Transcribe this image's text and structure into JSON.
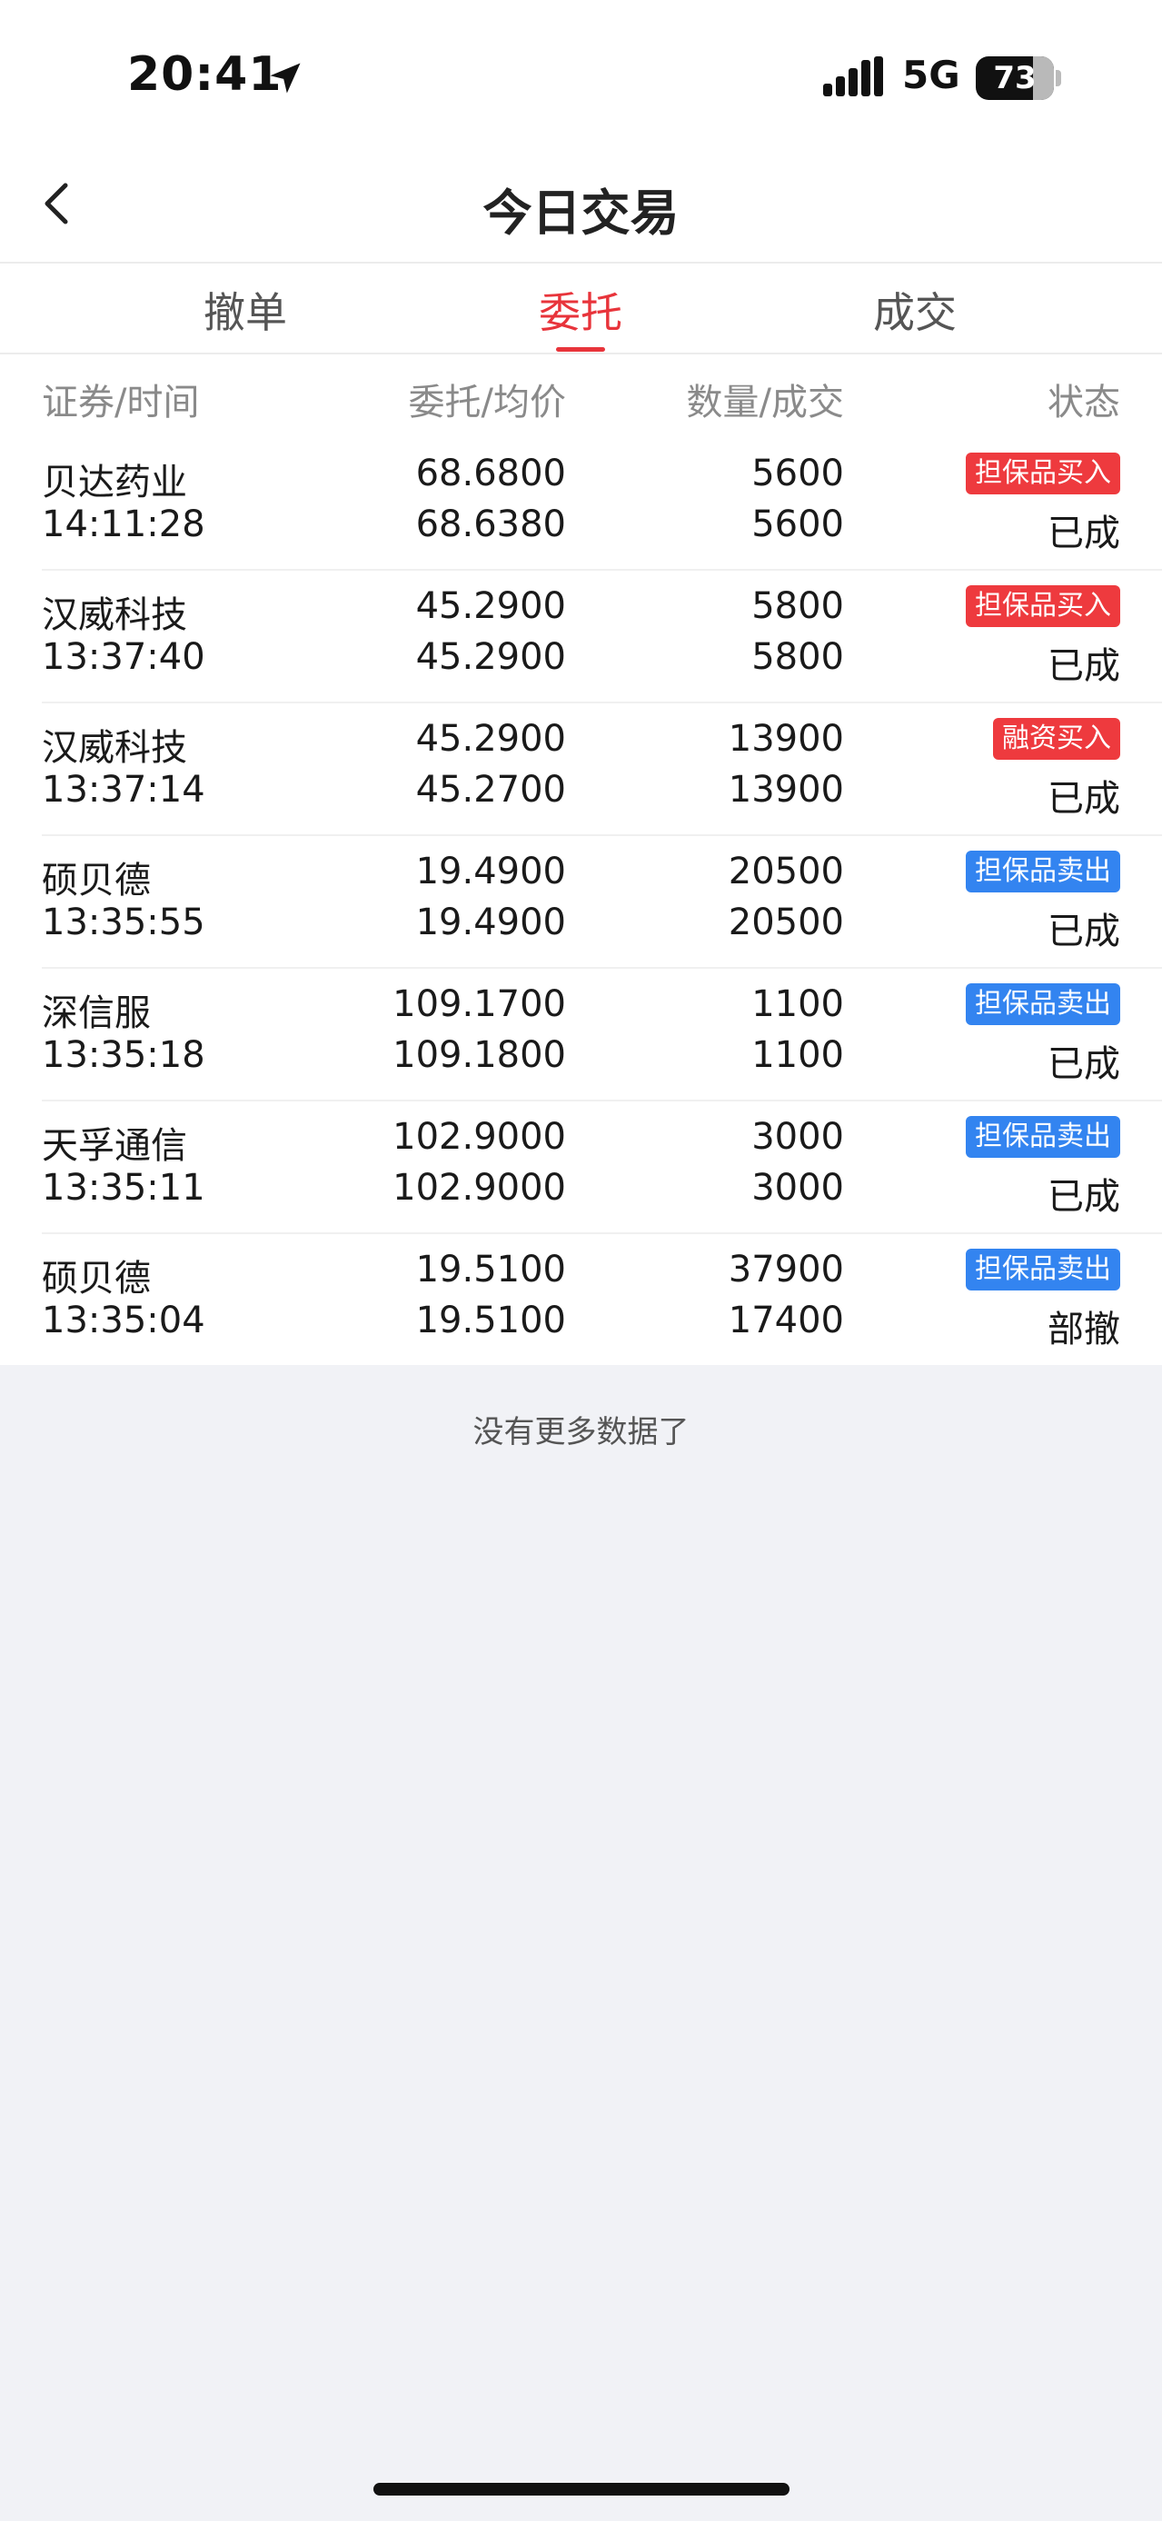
{
  "status_bar": {
    "time": "20:41",
    "network": "5G",
    "battery": "73",
    "battery_level_percent": 73,
    "location_icon": "location-arrow-icon",
    "signal_icon": "cellular-signal-icon"
  },
  "nav": {
    "title": "今日交易",
    "back_icon": "chevron-left-icon"
  },
  "tabs": [
    {
      "label": "撤单",
      "active": false
    },
    {
      "label": "委托",
      "active": true
    },
    {
      "label": "成交",
      "active": false
    }
  ],
  "columns": [
    "证券/时间",
    "委托/均价",
    "数量/成交",
    "状态"
  ],
  "orders": [
    {
      "name": "贝达药业",
      "time": "14:11:28",
      "order_price": "68.6800",
      "avg_price": "68.6380",
      "quantity": "5600",
      "filled": "5600",
      "tag": "担保品买入",
      "tag_color": "#ee3a3e",
      "status": "已成"
    },
    {
      "name": "汉威科技",
      "time": "13:37:40",
      "order_price": "45.2900",
      "avg_price": "45.2900",
      "quantity": "5800",
      "filled": "5800",
      "tag": "担保品买入",
      "tag_color": "#ee3a3e",
      "status": "已成"
    },
    {
      "name": "汉威科技",
      "time": "13:37:14",
      "order_price": "45.2900",
      "avg_price": "45.2700",
      "quantity": "13900",
      "filled": "13900",
      "tag": "融资买入",
      "tag_color": "#ee3a3e",
      "status": "已成"
    },
    {
      "name": "硕贝德",
      "time": "13:35:55",
      "order_price": "19.4900",
      "avg_price": "19.4900",
      "quantity": "20500",
      "filled": "20500",
      "tag": "担保品卖出",
      "tag_color": "#3384f0",
      "status": "已成"
    },
    {
      "name": "深信服",
      "time": "13:35:18",
      "order_price": "109.1700",
      "avg_price": "109.1800",
      "quantity": "1100",
      "filled": "1100",
      "tag": "担保品卖出",
      "tag_color": "#3384f0",
      "status": "已成"
    },
    {
      "name": "天孚通信",
      "time": "13:35:11",
      "order_price": "102.9000",
      "avg_price": "102.9000",
      "quantity": "3000",
      "filled": "3000",
      "tag": "担保品卖出",
      "tag_color": "#3384f0",
      "status": "已成"
    },
    {
      "name": "硕贝德",
      "time": "13:35:04",
      "order_price": "19.5100",
      "avg_price": "19.5100",
      "quantity": "37900",
      "filled": "17400",
      "tag": "担保品卖出",
      "tag_color": "#3384f0",
      "status": "部撤"
    }
  ],
  "footer_text": "没有更多数据了",
  "colors": {
    "accent": "#e8343b",
    "buy_tag": "#ee3a3e",
    "sell_tag": "#3384f0",
    "background": "#f1f2f6"
  }
}
